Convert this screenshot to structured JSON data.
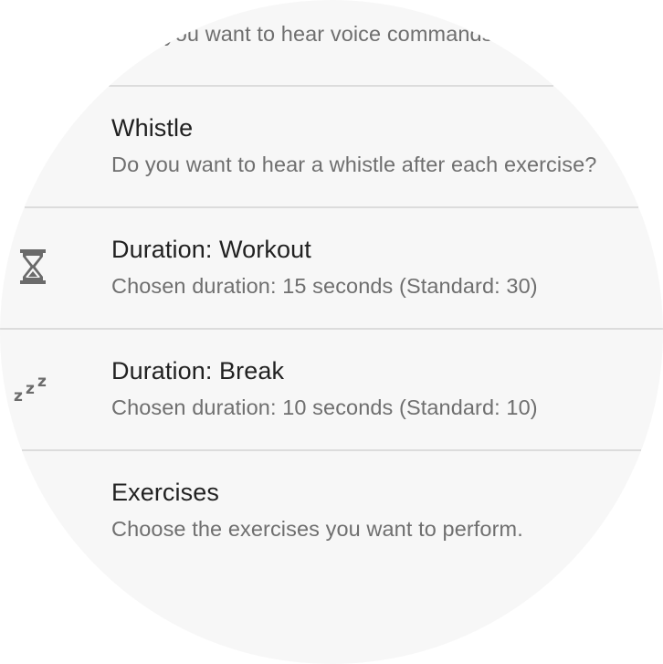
{
  "preferences": {
    "voice": {
      "summary": "Do you want to hear voice commands?"
    },
    "whistle": {
      "title": "Whistle",
      "summary": "Do you want to hear a whistle after each exercise?"
    },
    "duration_workout": {
      "icon": "hourglass-icon",
      "title": "Duration: Workout",
      "summary": "Chosen duration: 15 seconds (Standard: 30)"
    },
    "duration_break": {
      "icon": "sleep-zzz-icon",
      "title": "Duration: Break",
      "summary": "Chosen duration: 10 seconds (Standard: 10)"
    },
    "exercises": {
      "title": "Exercises",
      "summary": "Choose the exercises you want to perform."
    }
  },
  "colors": {
    "background": "#f7f7f7",
    "title_text": "#212121",
    "summary_text": "#6f6f6f",
    "icon": "#6b6b6b",
    "divider": "#dcdcdc"
  }
}
